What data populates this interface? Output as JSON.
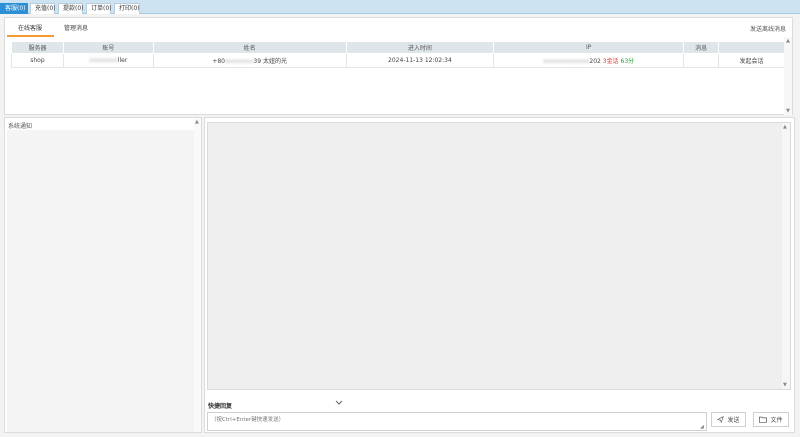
{
  "top_tabs": [
    {
      "label": "客服(0)"
    },
    {
      "label": "充值(0)"
    },
    {
      "label": "提款(0)"
    },
    {
      "label": "订单(0)"
    },
    {
      "label": "打印(0)"
    }
  ],
  "upper": {
    "tabs": [
      {
        "label": "在线客服"
      },
      {
        "label": "管理消息"
      }
    ],
    "send_offline": "发送离线消息",
    "columns": [
      "服务器",
      "账号",
      "姓名",
      "进入时间",
      "IP",
      "消息",
      ""
    ],
    "rows": [
      {
        "server": "shop",
        "account_masked": "xxxxxxxx",
        "account_suffix": "ller",
        "name_prefix": "+80",
        "name_masked": "xxxxxxxx",
        "name_suffix": "39 太妞的光",
        "entry_time": "2024-11-13 12:02:34",
        "ip_masked": "xxxxxxxxxxxxx",
        "ip_suffix": "202",
        "ip_tag_red": "3金话",
        "ip_tag_green": "63分",
        "message": "",
        "action": "发起会话"
      }
    ]
  },
  "left": {
    "title": "系统通知"
  },
  "right": {
    "quick_reply_label": "快捷回复",
    "input_placeholder": "（按Ctrl+Enter键快速发送）",
    "send_label": "发送",
    "file_label": "文件"
  },
  "colors": {
    "active_tab": "#2d8fd5",
    "tab_underline": "#f29a31",
    "red_tag": "#e23b3b",
    "green_tag": "#27a02d"
  }
}
